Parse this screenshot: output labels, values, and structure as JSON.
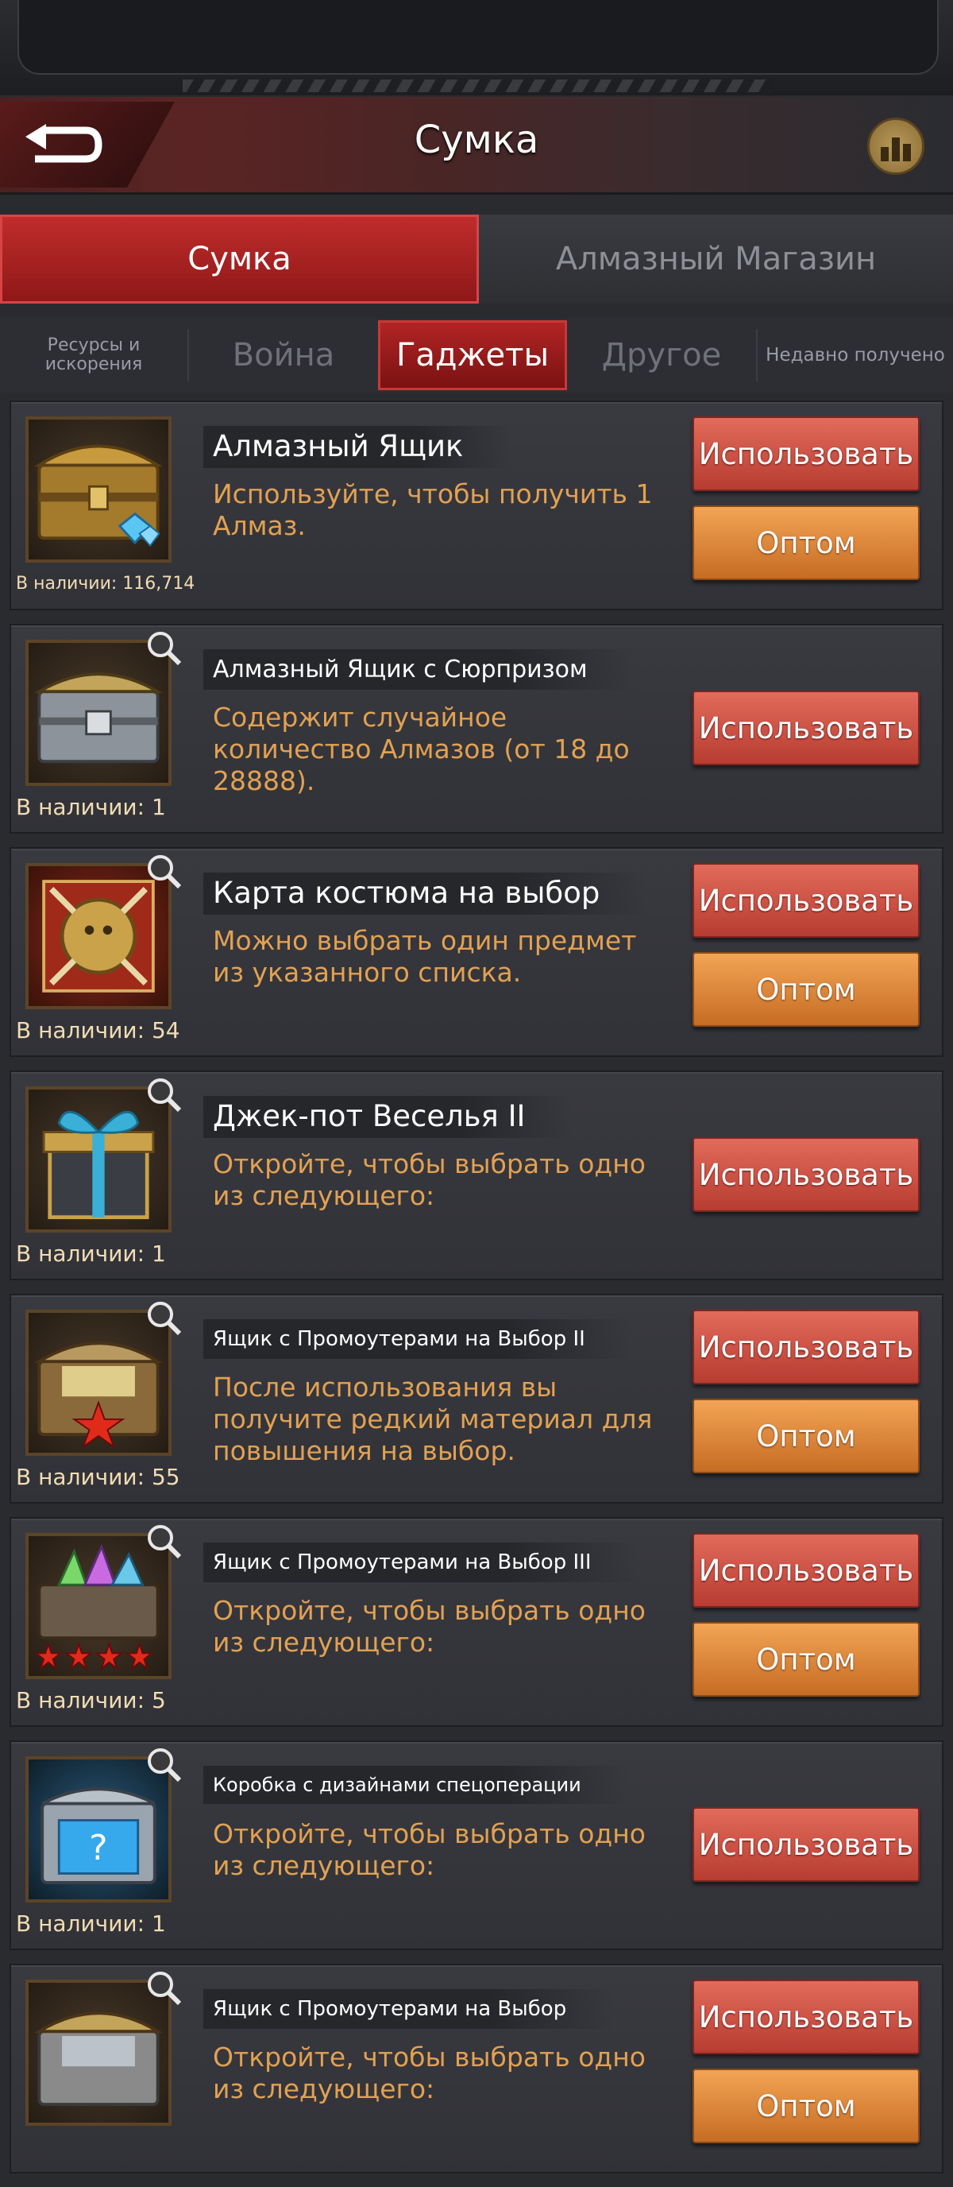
{
  "header": {
    "title": "Сумка"
  },
  "main_tabs": [
    {
      "label": "Сумка",
      "active": true
    },
    {
      "label": "Алмазный Магазин",
      "active": false
    }
  ],
  "sub_tabs": [
    {
      "label": "Ресурсы и искорения",
      "active": false
    },
    {
      "label": "Война",
      "active": false
    },
    {
      "label": "Гаджеты",
      "active": true
    },
    {
      "label": "Другое",
      "active": false
    },
    {
      "label": "Недавно получено",
      "active": false
    }
  ],
  "buttons": {
    "use": "Использовать",
    "bulk": "Оптом"
  },
  "items": [
    {
      "name": "Алмазный Ящик",
      "desc": "Используйте, чтобы получить 1 Алмаз.",
      "stock": "В наличии: 116,714",
      "icon": "diamond-chest-icon"
    },
    {
      "name": "Алмазный Ящик с Сюрпризом",
      "desc": "Содержит случайное количество Алмазов (от 18 до 28888).",
      "stock": "В наличии: 1",
      "icon": "silver-chest-icon"
    },
    {
      "name": "Карта костюма на выбор",
      "desc": "Можно выбрать один предмет из указанного списка.",
      "stock": "В наличии: 54",
      "icon": "costume-card-icon"
    },
    {
      "name": "Джек-пот Веселья II",
      "desc": "Откройте, чтобы выбрать одно из следующего:",
      "stock": "В наличии: 1",
      "icon": "gift-box-icon"
    },
    {
      "name": "Ящик с Промоутерами на Выбор II",
      "desc": "После использования вы получите редкий материал для повышения на выбор.",
      "stock": "В наличии: 55",
      "icon": "promoter-chest-icon"
    },
    {
      "name": "Ящик с Промоутерами на Выбор III",
      "desc": "Откройте, чтобы выбрать одно из следующего:",
      "stock": "В наличии: 5",
      "icon": "crystal-chest-icon"
    },
    {
      "name": "Коробка с дизайнами спецоперации",
      "desc": "Откройте, чтобы выбрать одно из следующего:",
      "stock": "В наличии: 1",
      "icon": "blue-mystery-box-icon"
    },
    {
      "name": "Ящик с Промоутерами на Выбор",
      "desc": "Откройте, чтобы выбрать одно из следующего:",
      "stock": "",
      "icon": "promoter-chest-icon"
    }
  ]
}
